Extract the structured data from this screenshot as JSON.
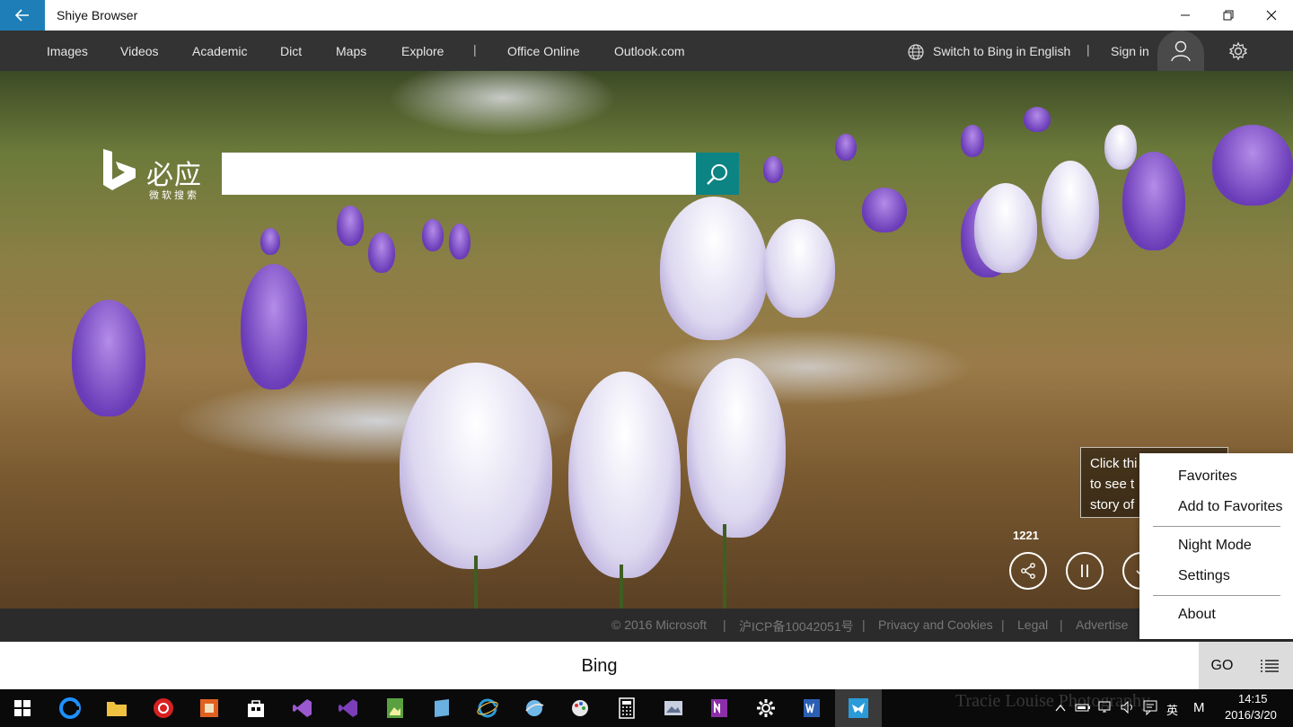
{
  "window": {
    "title": "Shiye Browser"
  },
  "nav": {
    "items": [
      "Images",
      "Videos",
      "Academic",
      "Dict",
      "Maps",
      "Explore"
    ],
    "divider": "|",
    "links": [
      "Office Online",
      "Outlook.com"
    ],
    "switch_lang": "Switch to Bing in English",
    "divider2": "|",
    "sign_in": "Sign in"
  },
  "logo": {
    "name": "必应",
    "subtitle": "微软搜索"
  },
  "search": {
    "placeholder": ""
  },
  "hero": {
    "tooltip_lines": [
      "Click thi",
      "to see t",
      "story of"
    ],
    "share_count": "1221"
  },
  "footer": {
    "copyright": "© 2016 Microsoft",
    "icp": "沪ICP备10042051号",
    "privacy": "Privacy and Cookies",
    "legal": "Legal",
    "advertise": "Advertise",
    "sep": "|"
  },
  "menu": {
    "items": [
      "Favorites",
      "Add to Favorites",
      "Night Mode",
      "Settings",
      "About"
    ]
  },
  "address_bar": {
    "value": "Bing",
    "go_label": "GO"
  },
  "taskbar": {
    "ghost_text": "Tracie Louise Photography",
    "ime": "英",
    "m": "M",
    "time": "14:15",
    "date": "2016/3/20"
  },
  "colors": {
    "accent": "#1e7fb8",
    "search_button": "#0c8484",
    "nav_bg": "#333333",
    "footer_bg": "#2b2b2b"
  }
}
